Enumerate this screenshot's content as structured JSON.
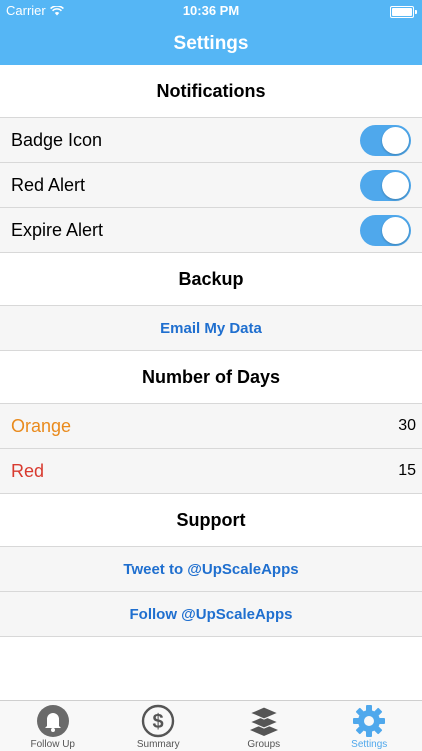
{
  "status_bar": {
    "carrier": "Carrier",
    "time": "10:36 PM"
  },
  "nav": {
    "title": "Settings"
  },
  "notifications": {
    "header": "Notifications",
    "items": [
      {
        "label": "Badge Icon",
        "on": true
      },
      {
        "label": "Red Alert",
        "on": true
      },
      {
        "label": "Expire Alert",
        "on": true
      }
    ]
  },
  "backup": {
    "header": "Backup",
    "email_label": "Email My Data"
  },
  "days": {
    "header": "Number of Days",
    "orange": {
      "label": "Orange",
      "value": "30"
    },
    "red": {
      "label": "Red",
      "value": "15"
    }
  },
  "support": {
    "header": "Support",
    "tweet_label": "Tweet to @UpScaleApps",
    "follow_label": "Follow @UpScaleApps"
  },
  "tabs": [
    {
      "label": "Follow Up",
      "icon": "bell-icon"
    },
    {
      "label": "Summary",
      "icon": "dollar-icon"
    },
    {
      "label": "Groups",
      "icon": "layers-icon"
    },
    {
      "label": "Settings",
      "icon": "gear-icon",
      "active": true
    }
  ],
  "colors": {
    "accent": "#55b6f5",
    "toggle_on": "#4fa8ec",
    "link": "#1f6fcf",
    "orange": "#e98a1c",
    "red": "#d83a2f"
  }
}
